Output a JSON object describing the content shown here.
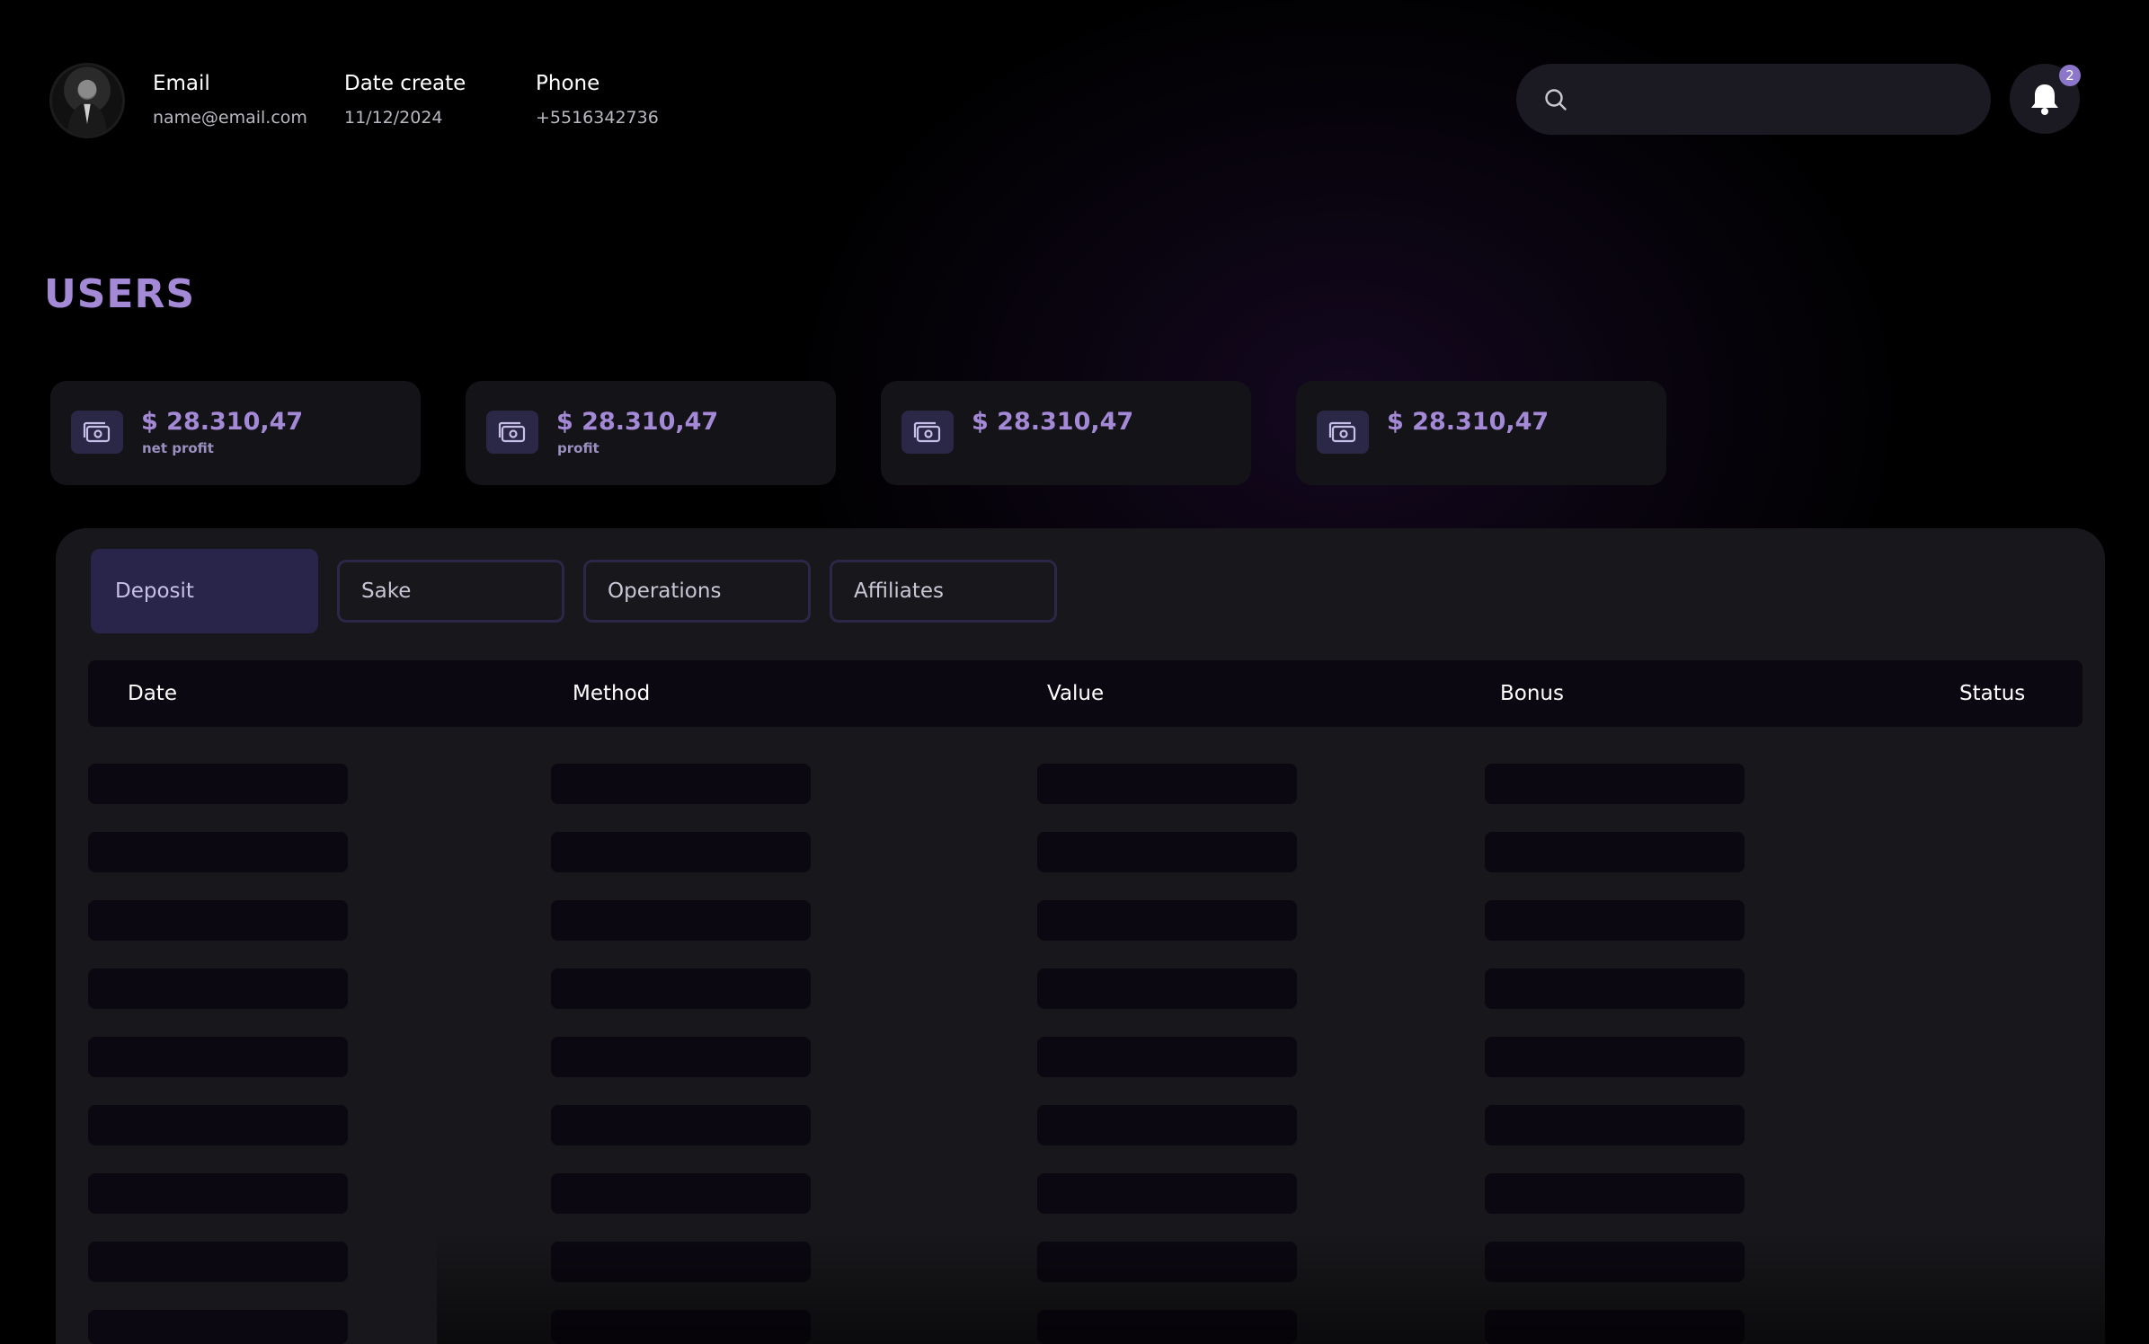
{
  "user": {
    "email_label": "Email",
    "email": "name@email.com",
    "date_label": "Date create",
    "date": "11/12/2024",
    "phone_label": "Phone",
    "phone": "+5516342736"
  },
  "search": {
    "placeholder": "",
    "icon": "search-icon"
  },
  "notifications": {
    "count": "2",
    "icon": "bell-icon"
  },
  "page_title": "USERS",
  "stats": [
    {
      "amount": "$ 28.310,47",
      "label": "net profit",
      "icon": "money-icon"
    },
    {
      "amount": "$ 28.310,47",
      "label": "profit",
      "icon": "money-icon"
    },
    {
      "amount": "$ 28.310,47",
      "label": "",
      "icon": "money-icon"
    },
    {
      "amount": "$ 28.310,47",
      "label": "",
      "icon": "money-icon"
    }
  ],
  "tabs": [
    {
      "label": "Deposit",
      "active": true
    },
    {
      "label": "Sake",
      "active": false
    },
    {
      "label": "Operations",
      "active": false
    },
    {
      "label": "Affiliates",
      "active": false
    }
  ],
  "table": {
    "columns": [
      "Date",
      "Method",
      "Value",
      "Bonus",
      "Status"
    ],
    "loading": true
  },
  "colors": {
    "accent": "#a48ad6",
    "tab_active": "#28244a",
    "panel": "#18171b",
    "skeleton": "#0c0812"
  }
}
